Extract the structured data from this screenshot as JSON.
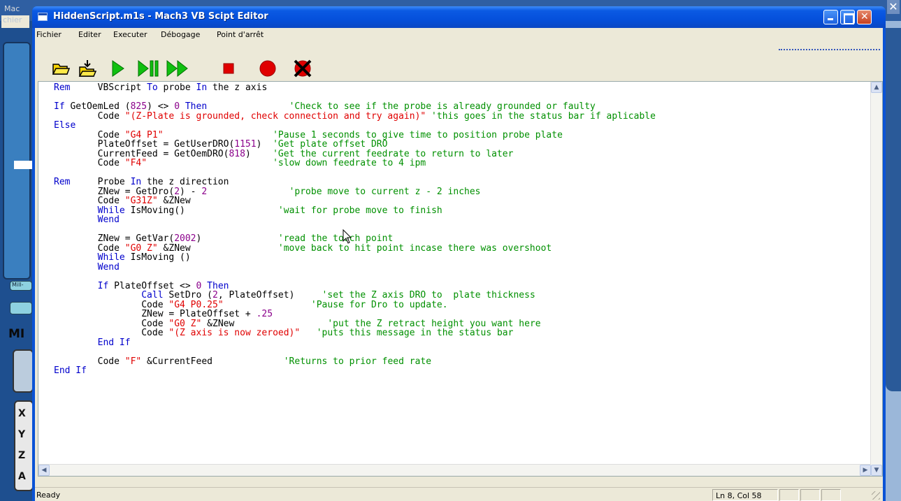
{
  "background_app": {
    "menu_fragment": "Mac",
    "menu_fragment2": "chier",
    "pill_label": "Mill-",
    "side_label": "MI",
    "axes": [
      "X",
      "Y",
      "Z",
      "A"
    ]
  },
  "window": {
    "title": "HiddenScript.m1s - Mach3 VB Scipt Editor"
  },
  "menu": {
    "items": [
      "Fichier",
      "Editer",
      "Executer",
      "Débogage",
      "Point d'arrêt"
    ]
  },
  "toolbar": {
    "buttons": [
      {
        "name": "open-folder-icon",
        "color": "#e8c000"
      },
      {
        "name": "save-folder-icon",
        "color": "#e8c000"
      },
      {
        "name": "run-icon",
        "color": "#00b000"
      },
      {
        "name": "step-pause-icon",
        "color": "#00b000"
      },
      {
        "name": "fast-forward-icon",
        "color": "#00b000"
      },
      {
        "name": "stop-icon",
        "color": "#e00000"
      },
      {
        "name": "breakpoint-icon",
        "color": "#e00000"
      },
      {
        "name": "clear-breakpoint-icon",
        "color": "#e00000"
      }
    ]
  },
  "code": {
    "colors": {
      "keyword": "#0000cc",
      "string": "#e00000",
      "number": "#8b008b",
      "comment": "#009000"
    },
    "lines": [
      [
        [
          "kw",
          "Rem"
        ],
        [
          "txt",
          "     VBScript "
        ],
        [
          "kw",
          "To"
        ],
        [
          "txt",
          " probe "
        ],
        [
          "kw",
          "In"
        ],
        [
          "txt",
          " the z axis"
        ]
      ],
      [],
      [
        [
          "kw",
          "If"
        ],
        [
          "txt",
          " GetOemLed ("
        ],
        [
          "num",
          "825"
        ],
        [
          "txt",
          ") <> "
        ],
        [
          "num",
          "0"
        ],
        [
          "kw",
          " Then"
        ],
        [
          "txt",
          "               "
        ],
        [
          "com",
          "'Check to see if the probe is already grounded or faulty"
        ]
      ],
      [
        [
          "txt",
          "        Code "
        ],
        [
          "str",
          "\"(Z-Plate is grounded, check connection and try again)\""
        ],
        [
          "txt",
          " "
        ],
        [
          "com",
          "'this goes in the status bar if aplicable"
        ]
      ],
      [
        [
          "kw",
          "Else"
        ]
      ],
      [
        [
          "txt",
          "        Code "
        ],
        [
          "str",
          "\"G4 P1\""
        ],
        [
          "txt",
          "                    "
        ],
        [
          "com",
          "'Pause 1 seconds to give time to position probe plate"
        ]
      ],
      [
        [
          "txt",
          "        PlateOffset = GetUserDRO("
        ],
        [
          "num",
          "1151"
        ],
        [
          "txt",
          ")  "
        ],
        [
          "com",
          "'Get plate offset DRO"
        ]
      ],
      [
        [
          "txt",
          "        CurrentFeed = GetOemDRO("
        ],
        [
          "num",
          "818"
        ],
        [
          "txt",
          ")    "
        ],
        [
          "com",
          "'Get the current feedrate to return to later"
        ]
      ],
      [
        [
          "txt",
          "        Code "
        ],
        [
          "str",
          "\"F4\""
        ],
        [
          "txt",
          "                       "
        ],
        [
          "com",
          "'slow down feedrate to 4 ipm"
        ]
      ],
      [],
      [
        [
          "kw",
          "Rem"
        ],
        [
          "txt",
          "     Probe "
        ],
        [
          "kw",
          "In"
        ],
        [
          "txt",
          " the z direction"
        ]
      ],
      [
        [
          "txt",
          "        ZNew = GetDro("
        ],
        [
          "num",
          "2"
        ],
        [
          "txt",
          ") - "
        ],
        [
          "num",
          "2"
        ],
        [
          "txt",
          "               "
        ],
        [
          "com",
          "'probe move to current z - 2 inches"
        ]
      ],
      [
        [
          "txt",
          "        Code "
        ],
        [
          "str",
          "\"G31Z\""
        ],
        [
          "txt",
          " &ZNew"
        ]
      ],
      [
        [
          "txt",
          "        "
        ],
        [
          "kw",
          "While"
        ],
        [
          "txt",
          " IsMoving()                 "
        ],
        [
          "com",
          "'wait for probe move to finish"
        ]
      ],
      [
        [
          "txt",
          "        "
        ],
        [
          "kw",
          "Wend"
        ]
      ],
      [],
      [
        [
          "txt",
          "        ZNew = GetVar("
        ],
        [
          "num",
          "2002"
        ],
        [
          "txt",
          ")              "
        ],
        [
          "com",
          "'read the touch point"
        ]
      ],
      [
        [
          "txt",
          "        Code "
        ],
        [
          "str",
          "\"G0 Z\""
        ],
        [
          "txt",
          " &ZNew                "
        ],
        [
          "com",
          "'move back to hit point incase there was overshoot"
        ]
      ],
      [
        [
          "txt",
          "        "
        ],
        [
          "kw",
          "While"
        ],
        [
          "txt",
          " IsMoving ()"
        ]
      ],
      [
        [
          "txt",
          "        "
        ],
        [
          "kw",
          "Wend"
        ]
      ],
      [],
      [
        [
          "txt",
          "        "
        ],
        [
          "kw",
          "If"
        ],
        [
          "txt",
          " PlateOffset <> "
        ],
        [
          "num",
          "0"
        ],
        [
          "kw",
          " Then"
        ]
      ],
      [
        [
          "txt",
          "                "
        ],
        [
          "kw",
          "Call"
        ],
        [
          "txt",
          " SetDro ("
        ],
        [
          "num",
          "2"
        ],
        [
          "txt",
          ", PlateOffset)     "
        ],
        [
          "com",
          "'set the Z axis DRO to  plate thickness"
        ]
      ],
      [
        [
          "txt",
          "                Code "
        ],
        [
          "str",
          "\"G4 P0.25\""
        ],
        [
          "txt",
          "                "
        ],
        [
          "com",
          "'Pause for Dro to update."
        ]
      ],
      [
        [
          "txt",
          "                ZNew = PlateOffset + "
        ],
        [
          "num",
          ".25"
        ]
      ],
      [
        [
          "txt",
          "                Code "
        ],
        [
          "str",
          "\"G0 Z\""
        ],
        [
          "txt",
          " &ZNew                 "
        ],
        [
          "com",
          "'put the Z retract height you want here"
        ]
      ],
      [
        [
          "txt",
          "                Code "
        ],
        [
          "str",
          "\"(Z axis is now zeroed)\""
        ],
        [
          "txt",
          "   "
        ],
        [
          "com",
          "'puts this message in the status bar"
        ]
      ],
      [
        [
          "txt",
          "        "
        ],
        [
          "kw",
          "End If"
        ]
      ],
      [],
      [
        [
          "txt",
          "        Code "
        ],
        [
          "str",
          "\"F\""
        ],
        [
          "txt",
          " &CurrentFeed             "
        ],
        [
          "com",
          "'Returns to prior feed rate"
        ]
      ],
      [
        [
          "kw",
          "End If"
        ]
      ]
    ]
  },
  "status": {
    "text": "Ready",
    "position": "Ln 8, Col 58"
  }
}
